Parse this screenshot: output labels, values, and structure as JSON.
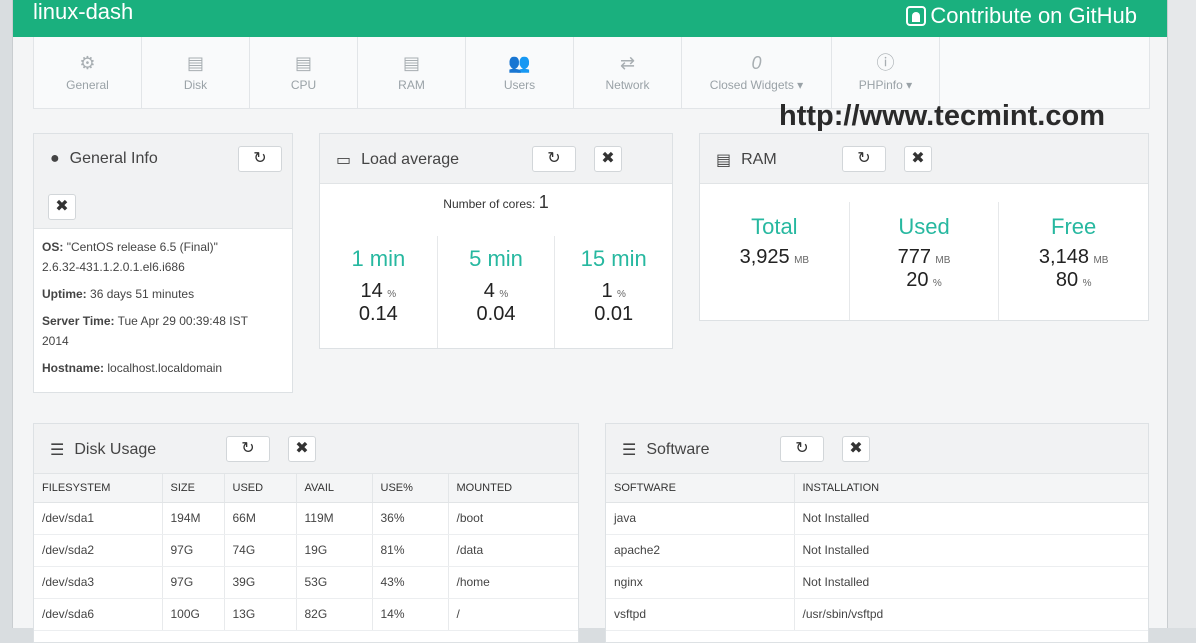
{
  "app": {
    "title": "linux-dash",
    "github_label": "Contribute on GitHub"
  },
  "nav": [
    {
      "label": "General",
      "icon": "dashboard-icon",
      "glyph": "⚙"
    },
    {
      "label": "Disk",
      "icon": "disk-icon",
      "glyph": "▤"
    },
    {
      "label": "CPU",
      "icon": "cpu-icon",
      "glyph": "▤"
    },
    {
      "label": "RAM",
      "icon": "ram-icon",
      "glyph": "▤"
    },
    {
      "label": "Users",
      "icon": "users-icon",
      "glyph": "👥"
    },
    {
      "label": "Network",
      "icon": "network-icon",
      "glyph": "⇄"
    },
    {
      "label": "Closed Widgets ▾",
      "count": "0",
      "icon": "closed-widgets-icon"
    },
    {
      "label": "PHPinfo ▾",
      "icon": "info-icon",
      "glyph": "ⓘ"
    }
  ],
  "watermark": "http://www.tecmint.com",
  "general_info": {
    "title": "General Info",
    "os_label": "OS:",
    "os_value": "\"CentOS release 6.5 (Final)\"",
    "kernel": "2.6.32-431.1.2.0.1.el6.i686",
    "uptime_label": "Uptime:",
    "uptime_value": "36 days 51 minutes",
    "server_time_label": "Server Time:",
    "server_time_value": "Tue Apr 29 00:39:48 IST",
    "server_time_year": "2014",
    "hostname_label": "Hostname:",
    "hostname_value": "localhost.localdomain"
  },
  "load_average": {
    "title": "Load average",
    "cores_label": "Number of cores:",
    "cores_value": "1",
    "cols": [
      {
        "label": "1 min",
        "pct": "14",
        "pct_unit": "%",
        "value": "0.14"
      },
      {
        "label": "5 min",
        "pct": "4",
        "pct_unit": "%",
        "value": "0.04"
      },
      {
        "label": "15 min",
        "pct": "1",
        "pct_unit": "%",
        "value": "0.01"
      }
    ]
  },
  "ram": {
    "title": "RAM",
    "cols": [
      {
        "label": "Total",
        "value": "3,925",
        "unit": "MB",
        "pct": "",
        "pct_unit": ""
      },
      {
        "label": "Used",
        "value": "777",
        "unit": "MB",
        "pct": "20",
        "pct_unit": "%"
      },
      {
        "label": "Free",
        "value": "3,148",
        "unit": "MB",
        "pct": "80",
        "pct_unit": "%"
      }
    ]
  },
  "disk_usage": {
    "title": "Disk Usage",
    "headers": [
      "FILESYSTEM",
      "SIZE",
      "USED",
      "AVAIL",
      "USE%",
      "MOUNTED"
    ],
    "rows": [
      [
        "/dev/sda1",
        "194M",
        "66M",
        "119M",
        "36%",
        "/boot"
      ],
      [
        "/dev/sda2",
        "97G",
        "74G",
        "19G",
        "81%",
        "/data"
      ],
      [
        "/dev/sda3",
        "97G",
        "39G",
        "53G",
        "43%",
        "/home"
      ],
      [
        "/dev/sda6",
        "100G",
        "13G",
        "82G",
        "14%",
        "/"
      ]
    ]
  },
  "software": {
    "title": "Software",
    "headers": [
      "SOFTWARE",
      "INSTALLATION"
    ],
    "rows": [
      [
        "java",
        "Not Installed"
      ],
      [
        "apache2",
        "Not Installed"
      ],
      [
        "nginx",
        "Not Installed"
      ],
      [
        "vsftpd",
        "/usr/sbin/vsftpd"
      ]
    ]
  },
  "buttons": {
    "refresh": "↻",
    "close": "✖"
  },
  "colors": {
    "header": "#1ab07e",
    "accent": "#27b8a0"
  }
}
